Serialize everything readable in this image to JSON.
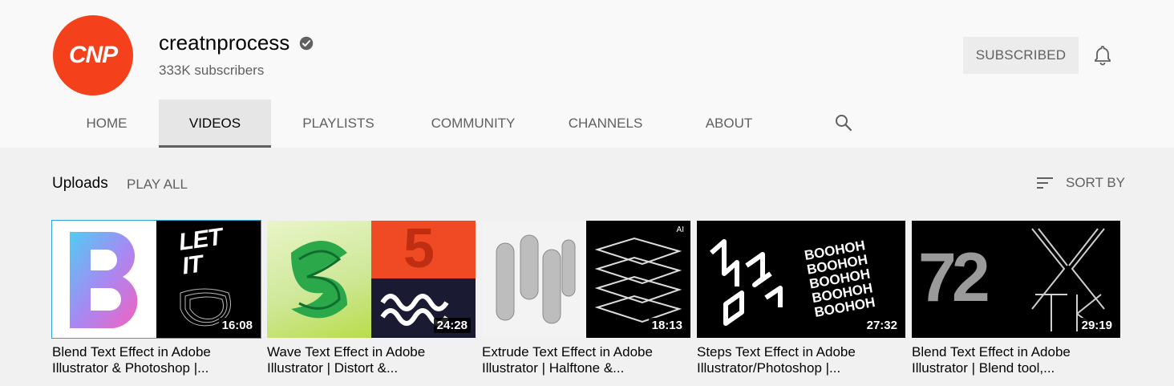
{
  "channel": {
    "avatar_text": "CNP",
    "name": "creatnprocess",
    "verified_icon": "check-circle-icon",
    "subscribers": "333K subscribers",
    "subscribe_label": "SUBSCRIBED",
    "bell_icon": "bell-icon",
    "brand_color": "#f4401b"
  },
  "tabs": [
    {
      "label": "HOME"
    },
    {
      "label": "VIDEOS",
      "active": true
    },
    {
      "label": "PLAYLISTS"
    },
    {
      "label": "COMMUNITY"
    },
    {
      "label": "CHANNELS"
    },
    {
      "label": "ABOUT"
    }
  ],
  "search_icon": "search-icon",
  "section": {
    "title": "Uploads",
    "play_all": "PLAY ALL",
    "sort_label": "SORT BY",
    "sort_icon": "sort-icon"
  },
  "videos": [
    {
      "title": "Blend Text Effect in Adobe Illustrator & Photoshop |...",
      "duration": "16:08",
      "thumb_text": "LET IT",
      "selected": true
    },
    {
      "title": "Wave Text Effect in Adobe Illustrator | Distort &...",
      "duration": "24:28",
      "thumb_text": "5"
    },
    {
      "title": "Extrude Text Effect in Adobe Illustrator | Halftone &...",
      "duration": "18:13",
      "thumb_text": "AI"
    },
    {
      "title": "Steps Text Effect in Adobe Illustrator/Photoshop |...",
      "duration": "27:32",
      "thumb_text": "BOOHOH"
    },
    {
      "title": "Blend Text Effect in Adobe Illustrator | Blend tool,...",
      "duration": "29:19",
      "thumb_text": "72"
    }
  ],
  "colors": {
    "selected_outline": "#2aa4dd",
    "subscribe_bg": "#ececec"
  }
}
